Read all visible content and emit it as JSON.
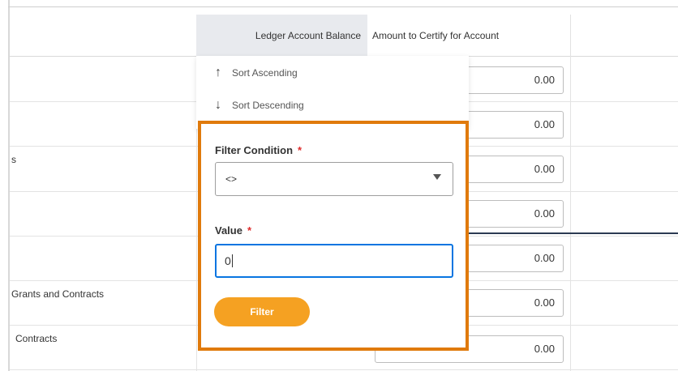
{
  "table": {
    "headers": {
      "ledger_balance": "Ledger Account Balance",
      "amount_to_certify": "Amount to Certify for Account"
    },
    "row_fragments": {
      "row3": "s",
      "row6": "Grants and Contracts",
      "row7": "Contracts"
    },
    "amount_values": [
      "0.00",
      "0.00",
      "0.00",
      "0.00",
      "0.00",
      "0.00",
      "0.00"
    ]
  },
  "menu": {
    "sort_ascending": "Sort Ascending",
    "sort_descending": "Sort Descending",
    "icons": {
      "ascending": "arrow-up-icon",
      "descending": "arrow-down-icon"
    }
  },
  "filter": {
    "condition_label": "Filter Condition",
    "condition_required": "*",
    "condition_value": "<>",
    "value_label": "Value",
    "value_required": "*",
    "value_input": "0",
    "button_label": "Filter"
  },
  "colors": {
    "highlight_border": "#e07a0c",
    "filter_button": "#f5a122",
    "focus_blue": "#0875e1",
    "required_red": "#de2b2b"
  }
}
